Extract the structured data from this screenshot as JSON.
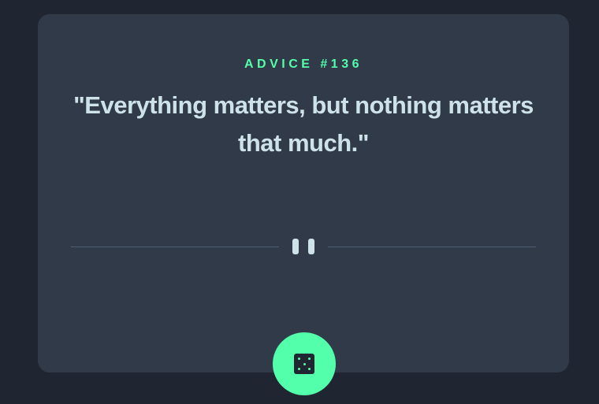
{
  "card": {
    "advice_label": "ADVICE #136",
    "quote": "\"Everything matters, but nothing matters that much.\""
  },
  "divider": {
    "icon": "pause-icon"
  },
  "dice_button": {
    "icon": "dice-icon"
  },
  "colors": {
    "background": "#1f2632",
    "card": "#313a48",
    "accent": "#53ffaa",
    "text": "#cee3e9",
    "divider": "#4f5d74"
  }
}
